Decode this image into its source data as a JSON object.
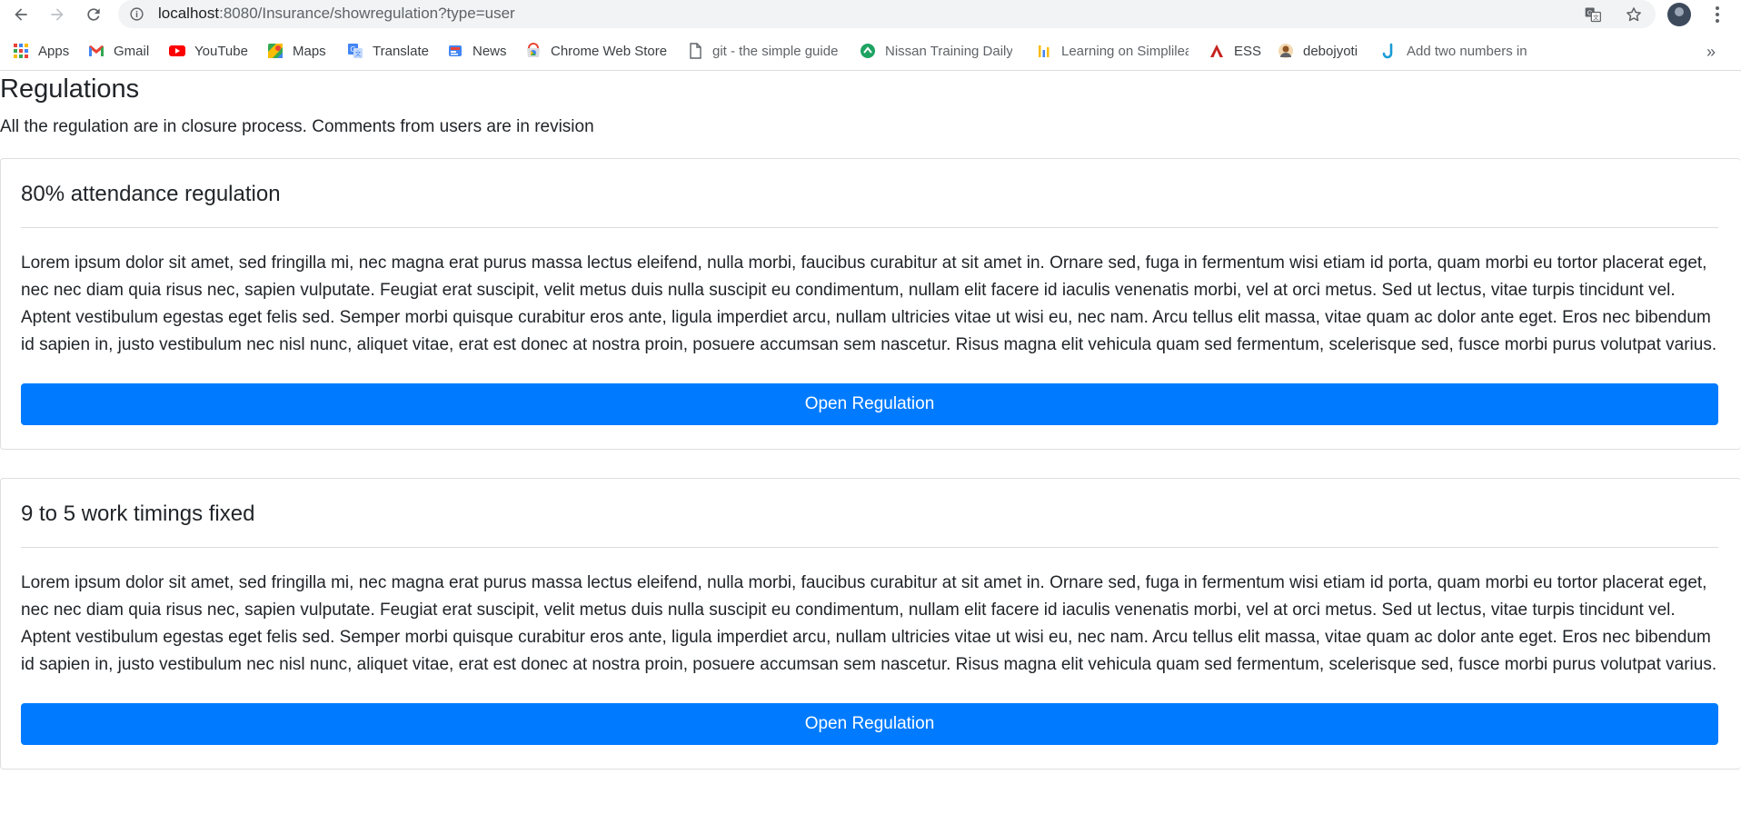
{
  "browser": {
    "url_host": "localhost",
    "url_path": ":8080/Insurance/showregulation?type=user",
    "bookmarks": [
      {
        "label": "Apps",
        "icon": "apps-grid-icon"
      },
      {
        "label": "Gmail",
        "icon": "gmail-icon"
      },
      {
        "label": "YouTube",
        "icon": "youtube-icon"
      },
      {
        "label": "Maps",
        "icon": "maps-icon"
      },
      {
        "label": "Translate",
        "icon": "translate-icon"
      },
      {
        "label": "News",
        "icon": "news-icon"
      },
      {
        "label": "Chrome Web Store",
        "icon": "chrome-web-store-icon"
      },
      {
        "label": "git - the simple guide",
        "icon": "page-icon"
      },
      {
        "label": "Nissan Training Daily",
        "icon": "nissan-icon"
      },
      {
        "label": "Learning on Simplilearn",
        "icon": "simplilearn-icon"
      },
      {
        "label": "ESS",
        "icon": "ess-icon"
      },
      {
        "label": "debojyoti",
        "icon": "avatar-icon"
      },
      {
        "label": "Add two numbers in",
        "icon": "j-icon"
      }
    ],
    "more_label": "»"
  },
  "page": {
    "title": "Regulations",
    "subtitle": "All the regulation are in closure process. Comments from users are in revision"
  },
  "regulations": [
    {
      "title": "80% attendance regulation",
      "body": "Lorem ipsum dolor sit amet, sed fringilla mi, nec magna erat purus massa lectus eleifend, nulla morbi, faucibus curabitur at sit amet in. Ornare sed, fuga in fermentum wisi etiam id porta, quam morbi eu tortor placerat eget, nec nec diam quia risus nec, sapien vulputate. Feugiat erat suscipit, velit metus duis nulla suscipit eu condimentum, nullam elit facere id iaculis venenatis morbi, vel at orci metus. Sed ut lectus, vitae turpis tincidunt vel. Aptent vestibulum egestas eget felis sed. Semper morbi quisque curabitur eros ante, ligula imperdiet arcu, nullam ultricies vitae ut wisi eu, nec nam. Arcu tellus elit massa, vitae quam ac dolor ante eget. Eros nec bibendum id sapien in, justo vestibulum nec nisl nunc, aliquet vitae, erat est donec at nostra proin, posuere accumsan sem nascetur. Risus magna elit vehicula quam sed fermentum, scelerisque sed, fusce morbi purus volutpat varius.",
      "button": "Open Regulation"
    },
    {
      "title": "9 to 5 work timings fixed",
      "body": "Lorem ipsum dolor sit amet, sed fringilla mi, nec magna erat purus massa lectus eleifend, nulla morbi, faucibus curabitur at sit amet in. Ornare sed, fuga in fermentum wisi etiam id porta, quam morbi eu tortor placerat eget, nec nec diam quia risus nec, sapien vulputate. Feugiat erat suscipit, velit metus duis nulla suscipit eu condimentum, nullam elit facere id iaculis venenatis morbi, vel at orci metus. Sed ut lectus, vitae turpis tincidunt vel. Aptent vestibulum egestas eget felis sed. Semper morbi quisque curabitur eros ante, ligula imperdiet arcu, nullam ultricies vitae ut wisi eu, nec nam. Arcu tellus elit massa, vitae quam ac dolor ante eget. Eros nec bibendum id sapien in, justo vestibulum nec nisl nunc, aliquet vitae, erat est donec at nostra proin, posuere accumsan sem nascetur. Risus magna elit vehicula quam sed fermentum, scelerisque sed, fusce morbi purus volutpat varius.",
      "button": "Open Regulation"
    }
  ],
  "colors": {
    "primary_button": "#007bff",
    "omnibox_bg": "#f1f3f4"
  }
}
